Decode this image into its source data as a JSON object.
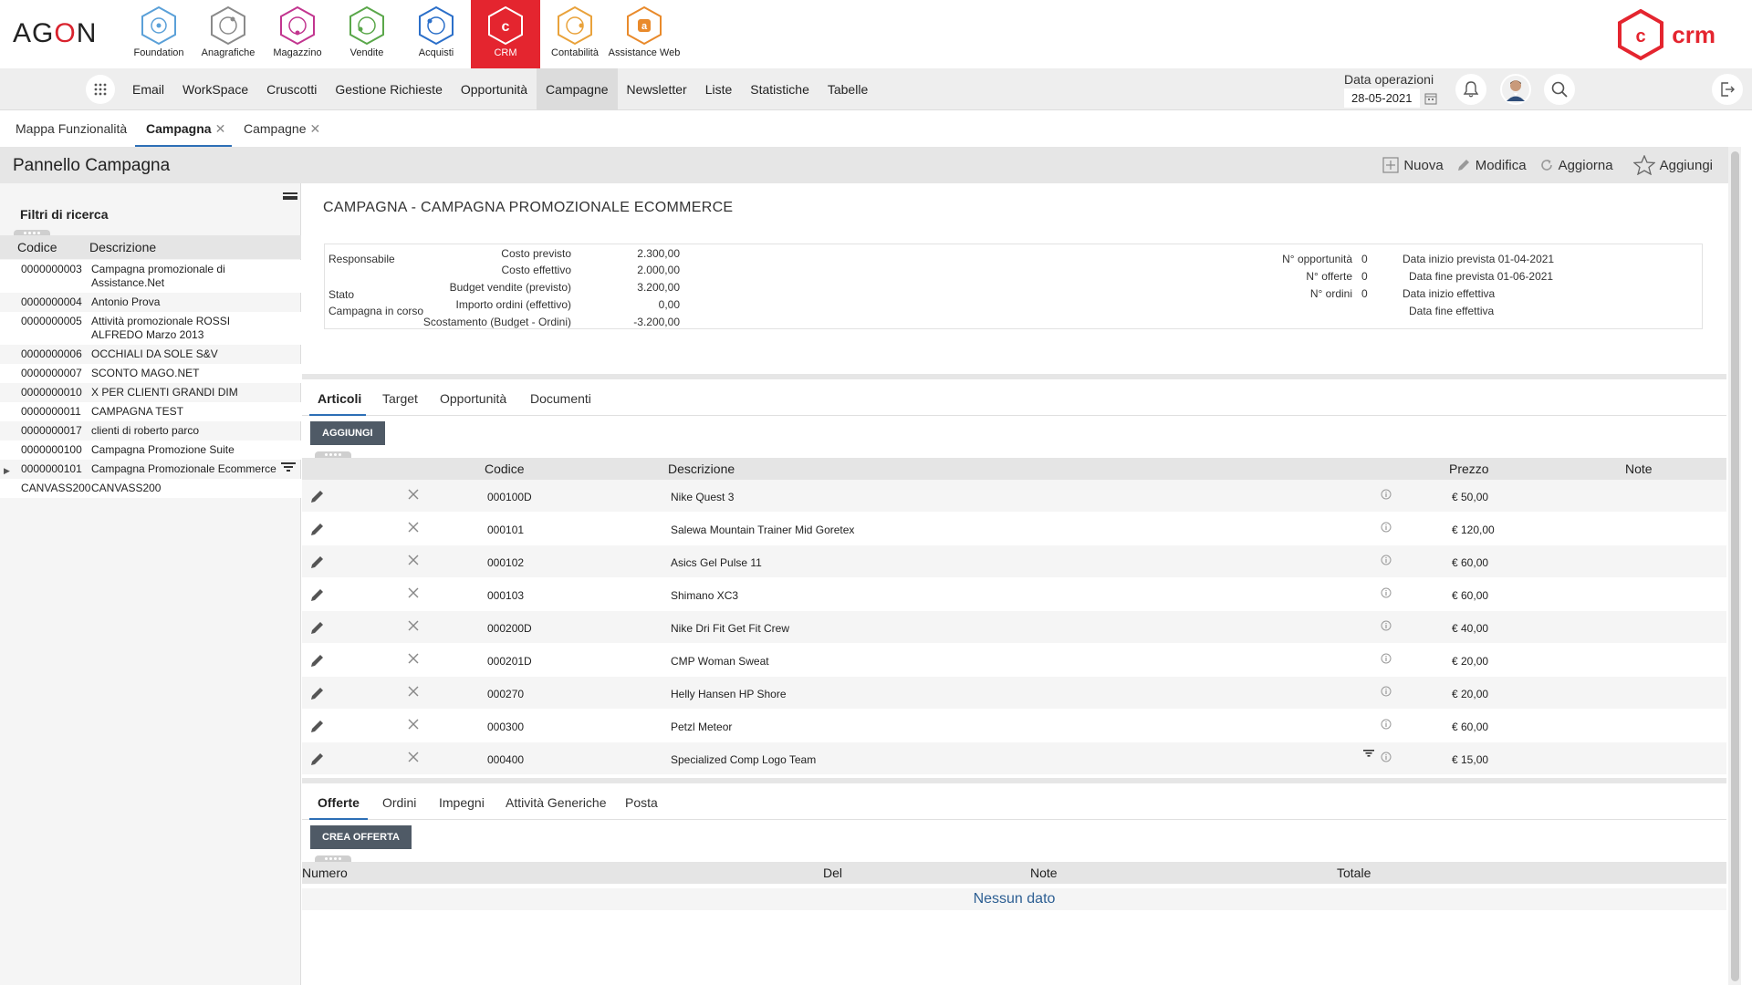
{
  "brand": {
    "logo_left": "AG",
    "logo_o": "O",
    "logo_right": "N",
    "crm_logo_text": "crm"
  },
  "colors": {
    "crm_red": "#e4252f",
    "accent_blue": "#2d6fb6",
    "button_dark": "#4f5a66"
  },
  "apps": [
    {
      "label": "Foundation",
      "color": "#5aa0d8"
    },
    {
      "label": "Anagrafiche",
      "color": "#8a8a8a"
    },
    {
      "label": "Magazzino",
      "color": "#c2358f"
    },
    {
      "label": "Vendite",
      "color": "#5aa74a"
    },
    {
      "label": "Acquisti",
      "color": "#2b6fc9"
    },
    {
      "label": "CRM",
      "color": "#ffffff"
    },
    {
      "label": "Contabilità",
      "color": "#e9a23b"
    },
    {
      "label": "Assistance Web",
      "color": "#e98a2b"
    }
  ],
  "nav": {
    "items": [
      "Email",
      "WorkSpace",
      "Cruscotti",
      "Gestione Richieste",
      "Opportunità",
      "Campagne",
      "Newsletter",
      "Liste",
      "Statistiche",
      "Tabelle"
    ],
    "active": "Campagne",
    "data_operazioni_label": "Data operazioni",
    "data_operazioni_value": "28-05-2021"
  },
  "doc_tabs": [
    {
      "label": "Mappa Funzionalità"
    },
    {
      "label": "Campagna"
    },
    {
      "label": "Campagne"
    }
  ],
  "title_bar": {
    "title": "Pannello Campagna",
    "actions": {
      "nuova": "Nuova",
      "modifica": "Modifica",
      "aggiorna": "Aggiorna",
      "aggiungi": "Aggiungi"
    }
  },
  "left_panel": {
    "filter_title": "Filtri di ricerca",
    "col_code": "Codice",
    "col_desc": "Descrizione",
    "rows": [
      {
        "code": "0000000003",
        "desc": "Campagna promozionale di Assistance.Net"
      },
      {
        "code": "0000000004",
        "desc": "Antonio Prova"
      },
      {
        "code": "0000000005",
        "desc": "Attività promozionale ROSSI ALFREDO Marzo 2013"
      },
      {
        "code": "0000000006",
        "desc": "OCCHIALI DA SOLE S&V"
      },
      {
        "code": "0000000007",
        "desc": "SCONTO MAGO.NET"
      },
      {
        "code": "0000000010",
        "desc": "X PER CLIENTI GRANDI DIM"
      },
      {
        "code": "0000000011",
        "desc": "CAMPAGNA TEST"
      },
      {
        "code": "0000000017",
        "desc": "clienti di roberto parco"
      },
      {
        "code": "0000000100",
        "desc": "Campagna Promozione Suite"
      },
      {
        "code": "0000000101",
        "desc": "Campagna Promozionale Ecommerce"
      },
      {
        "code": "CANVASS200",
        "desc": "CANVASS200"
      }
    ]
  },
  "campaign": {
    "title": "CAMPAGNA - CAMPAGNA PROMOZIONALE ECOMMERCE",
    "responsabile_label": "Responsabile",
    "stato_label": "Stato",
    "stato_value": "Campagna in corso",
    "costo_previsto_label": "Costo previsto",
    "costo_previsto": "2.300,00",
    "costo_effettivo_label": "Costo effettivo",
    "costo_effettivo": "2.000,00",
    "budget_label": "Budget vendite (previsto)",
    "budget": "3.200,00",
    "importo_label": "Importo ordini (effettivo)",
    "importo": "0,00",
    "scostamento_label": "Scostamento (Budget - Ordini)",
    "scostamento": "-3.200,00",
    "n_opportunita_label": "N° opportunità",
    "n_opportunita": "0",
    "n_offerte_label": "N° offerte",
    "n_offerte": "0",
    "n_ordini_label": "N° ordini",
    "n_ordini": "0",
    "data_inizio_prevista": "Data inizio prevista 01-04-2021",
    "data_fine_prevista": "Data fine prevista 01-06-2021",
    "data_inizio_effettiva": "Data inizio effettiva",
    "data_fine_effettiva": "Data fine effettiva"
  },
  "articoli": {
    "tabs": [
      "Articoli",
      "Target",
      "Opportunità",
      "Documenti"
    ],
    "add_button": "AGGIUNGI",
    "headers": {
      "codice": "Codice",
      "descrizione": "Descrizione",
      "prezzo": "Prezzo",
      "note": "Note"
    },
    "rows": [
      {
        "code": "000100D",
        "desc": "Nike Quest 3",
        "price": "€ 50,00"
      },
      {
        "code": "000101",
        "desc": "Salewa Mountain Trainer Mid Goretex",
        "price": "€ 120,00"
      },
      {
        "code": "000102",
        "desc": "Asics Gel Pulse 11",
        "price": "€ 60,00"
      },
      {
        "code": "000103",
        "desc": "Shimano XC3",
        "price": "€ 60,00"
      },
      {
        "code": "000200D",
        "desc": "Nike Dri Fit Get Fit Crew",
        "price": "€ 40,00"
      },
      {
        "code": "000201D",
        "desc": "CMP Woman Sweat",
        "price": "€ 20,00"
      },
      {
        "code": "000270",
        "desc": "Helly Hansen HP Shore",
        "price": "€ 20,00"
      },
      {
        "code": "000300",
        "desc": "Petzl Meteor",
        "price": "€ 60,00"
      },
      {
        "code": "000400",
        "desc": "Specialized Comp Logo Team",
        "price": "€ 15,00"
      }
    ]
  },
  "offerte": {
    "tabs": [
      "Offerte",
      "Ordini",
      "Impegni",
      "Attività Generiche",
      "Posta"
    ],
    "create_button": "CREA OFFERTA",
    "headers": {
      "numero": "Numero",
      "del": "Del",
      "note": "Note",
      "totale": "Totale"
    },
    "empty": "Nessun dato"
  }
}
